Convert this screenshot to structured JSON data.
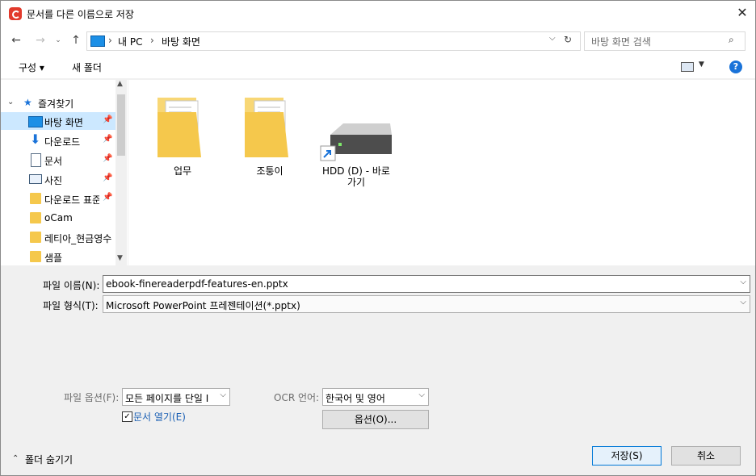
{
  "window": {
    "title": "문서를 다른 이름으로 저장"
  },
  "nav": {
    "breadcrumb": [
      "내 PC",
      "바탕 화면"
    ],
    "search_placeholder": "바탕 화면 검색"
  },
  "toolbar": {
    "organize_label": "구성 ▾",
    "new_folder_label": "새 폴더"
  },
  "sidebar": {
    "favorites_label": "즐겨찾기",
    "items": [
      {
        "label": "바탕 화면",
        "icon": "desktop-icon",
        "pinned": true
      },
      {
        "label": "다운로드",
        "icon": "download-icon",
        "pinned": true
      },
      {
        "label": "문서",
        "icon": "document-icon",
        "pinned": true
      },
      {
        "label": "사진",
        "icon": "picture-icon",
        "pinned": true
      },
      {
        "label": "다운로드 표준",
        "icon": "folder-icon",
        "pinned": true
      },
      {
        "label": "oCam",
        "icon": "folder-icon",
        "pinned": false
      },
      {
        "label": "레티아_현금영수",
        "icon": "folder-icon",
        "pinned": false
      },
      {
        "label": "샘플",
        "icon": "folder-icon",
        "pinned": false
      }
    ]
  },
  "content": {
    "items": [
      {
        "label": "업무",
        "type": "folder"
      },
      {
        "label": "조퉁이",
        "type": "folder"
      },
      {
        "label_line1": "HDD (D) - 바로",
        "label_line2": "가기",
        "type": "drive-shortcut"
      }
    ]
  },
  "form": {
    "filename_label": "파일 이름(N):",
    "filename_value": "ebook-finereaderpdf-features-en.pptx",
    "filetype_label": "파일 형식(T):",
    "filetype_value": "Microsoft PowerPoint 프레젠테이션(*.pptx)",
    "file_options_label": "파일 옵션(F):",
    "file_options_value": "모든 페이지를 단일 I",
    "open_doc_label": "문서 열기(E)",
    "open_doc_checked": true,
    "ocr_label": "OCR 언어:",
    "ocr_value": "한국어 및 영어",
    "options_button": "옵션(O)..."
  },
  "footer": {
    "hide_folders_label": "폴더 숨기기",
    "save_button": "저장(S)",
    "cancel_button": "취소"
  },
  "colors": {
    "accent": "#0078d7",
    "selected_bg": "#cce8ff",
    "folder": "#f5c84c"
  }
}
